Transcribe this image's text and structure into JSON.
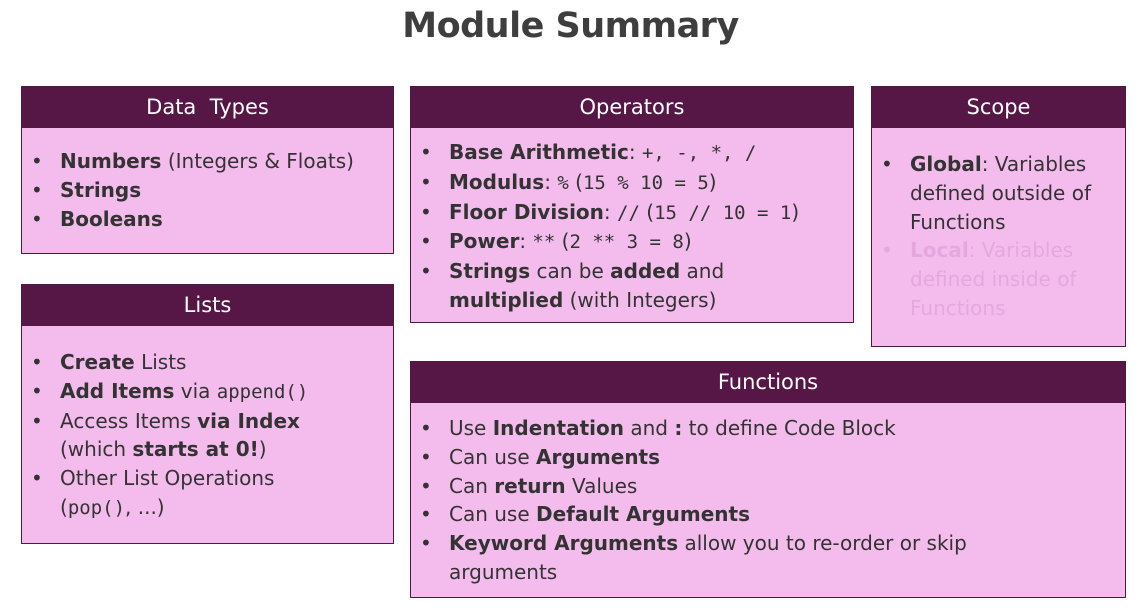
{
  "title": "Module Summary",
  "colors": {
    "header_bg": "#561646",
    "box_bg": "#f4bcec",
    "text": "#333333",
    "faded_text": "#e5a8de"
  },
  "data_types": {
    "header": "Data  Types",
    "numbers_bold": "Numbers",
    "numbers_rest": " (Integers & Floats)",
    "strings": "Strings",
    "booleans": "Booleans"
  },
  "lists": {
    "header": "Lists",
    "create_bold": "Create",
    "create_rest": " Lists",
    "add_bold": "Add Items",
    "add_mid": " via ",
    "add_code": "append()",
    "access_pre": "Access Items ",
    "access_bold": "via Index",
    "access_line2_pre": "(which ",
    "access_line2_bold": "starts at 0!",
    "access_line2_post": ")",
    "other_line1": "Other List Operations",
    "other_line2_pre": "(",
    "other_line2_code": "pop()",
    "other_line2_post": ", ...)"
  },
  "operators": {
    "header": "Operators",
    "arith_bold": "Base Arithmetic",
    "arith_colon": ": ",
    "arith_code": "+, -, *, /",
    "mod_bold": "Modulus",
    "mod_colon": ": ",
    "mod_code1": "%",
    "mod_paren_open": " (",
    "mod_code2": "15 % 10 = 5",
    "mod_paren_close": ")",
    "floor_bold": "Floor Division",
    "floor_colon": ": ",
    "floor_code1": "//",
    "floor_paren_open": " (",
    "floor_code2": "15 // 10 = 1",
    "floor_paren_close": ")",
    "power_bold": "Power",
    "power_colon": ": ",
    "power_code1": "**",
    "power_paren_open": " (",
    "power_code2": "2 ** 3 = 8",
    "power_paren_close": ")",
    "strings_bold": "Strings",
    "strings_mid": " can be ",
    "strings_bold2": "added",
    "strings_post": " and",
    "strings_line2_bold": "multiplied",
    "strings_line2_rest": " (with Integers)"
  },
  "scope": {
    "header": "Scope",
    "global_bold": "Global",
    "global_rest": ": Variables",
    "global_line2": "defined outside of",
    "global_line3": "Functions",
    "local_bold": "Local",
    "local_rest": ": Variables",
    "local_line2": "defined inside of",
    "local_line3": "Functions"
  },
  "functions": {
    "header": "Functions",
    "use_pre": "Use ",
    "use_bold1": "Indentation",
    "use_mid": " and ",
    "use_bold2": ":",
    "use_post": " to define Code Block",
    "args_pre": "Can use ",
    "args_bold": "Arguments",
    "return_pre": "Can ",
    "return_bold": "return",
    "return_post": " Values",
    "default_pre": "Can use ",
    "default_bold": "Default Arguments",
    "keyword_bold": "Keyword Arguments",
    "keyword_rest": " allow you to re-order or skip",
    "keyword_line2": "arguments"
  }
}
